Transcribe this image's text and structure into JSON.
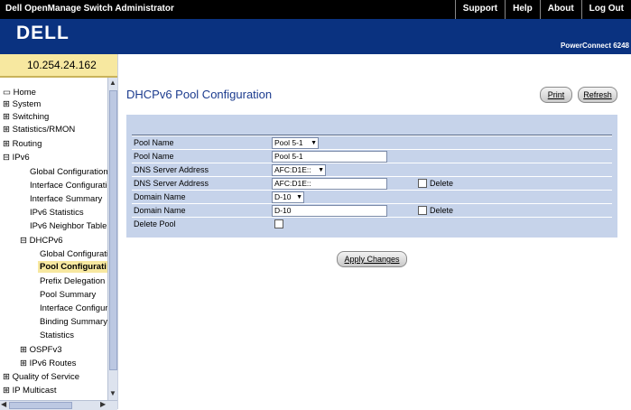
{
  "window": {
    "title": "Dell OpenManage Switch Administrator"
  },
  "top_links": [
    "Support",
    "Help",
    "About",
    "Log Out"
  ],
  "brand": {
    "logo": "DELL",
    "model": "PowerConnect 6248"
  },
  "device_ip": "10.254.24.162",
  "nav": {
    "items": [
      "Home",
      "System",
      "Switching",
      "Statistics/RMON",
      "Routing",
      "IPv6",
      "Global Configuration",
      "Interface Configuratio",
      "Interface Summary",
      "IPv6 Statistics",
      "IPv6 Neighbor Table",
      "DHCPv6",
      "Global Configuratic",
      "Pool Configurati",
      "Prefix Delegation C",
      "Pool Summary",
      "Interface Configura",
      "Binding Summary",
      "Statistics",
      "OSPFv3",
      "IPv6 Routes",
      "Quality of Service",
      "IP Multicast"
    ],
    "active": "Pool Configurati"
  },
  "page": {
    "title": "DHCPv6 Pool Configuration"
  },
  "toolbar": {
    "print_label": "Print",
    "refresh_label": "Refresh"
  },
  "form": {
    "pool_name_select_label": "Pool Name",
    "pool_name_select_value": "Pool 5-1",
    "pool_name_label": "Pool Name",
    "pool_name_value": "Pool 5-1",
    "dns_select_label": "DNS Server Address",
    "dns_select_value": "AFC:D1E::",
    "dns_label": "DNS Server Address",
    "dns_value": "AFC:D1E::",
    "dns_delete_label": "Delete",
    "domain_select_label": "Domain Name",
    "domain_select_value": "D-10",
    "domain_label": "Domain Name",
    "domain_value": "D-10",
    "domain_delete_label": "Delete",
    "delete_pool_label": "Delete Pool"
  },
  "actions": {
    "apply_label": "Apply Changes"
  },
  "colors": {
    "accent": "#1b3b8e",
    "banner": "#0a3280",
    "panel": "#c6d3ea",
    "highlight": "#f7e8a0"
  }
}
